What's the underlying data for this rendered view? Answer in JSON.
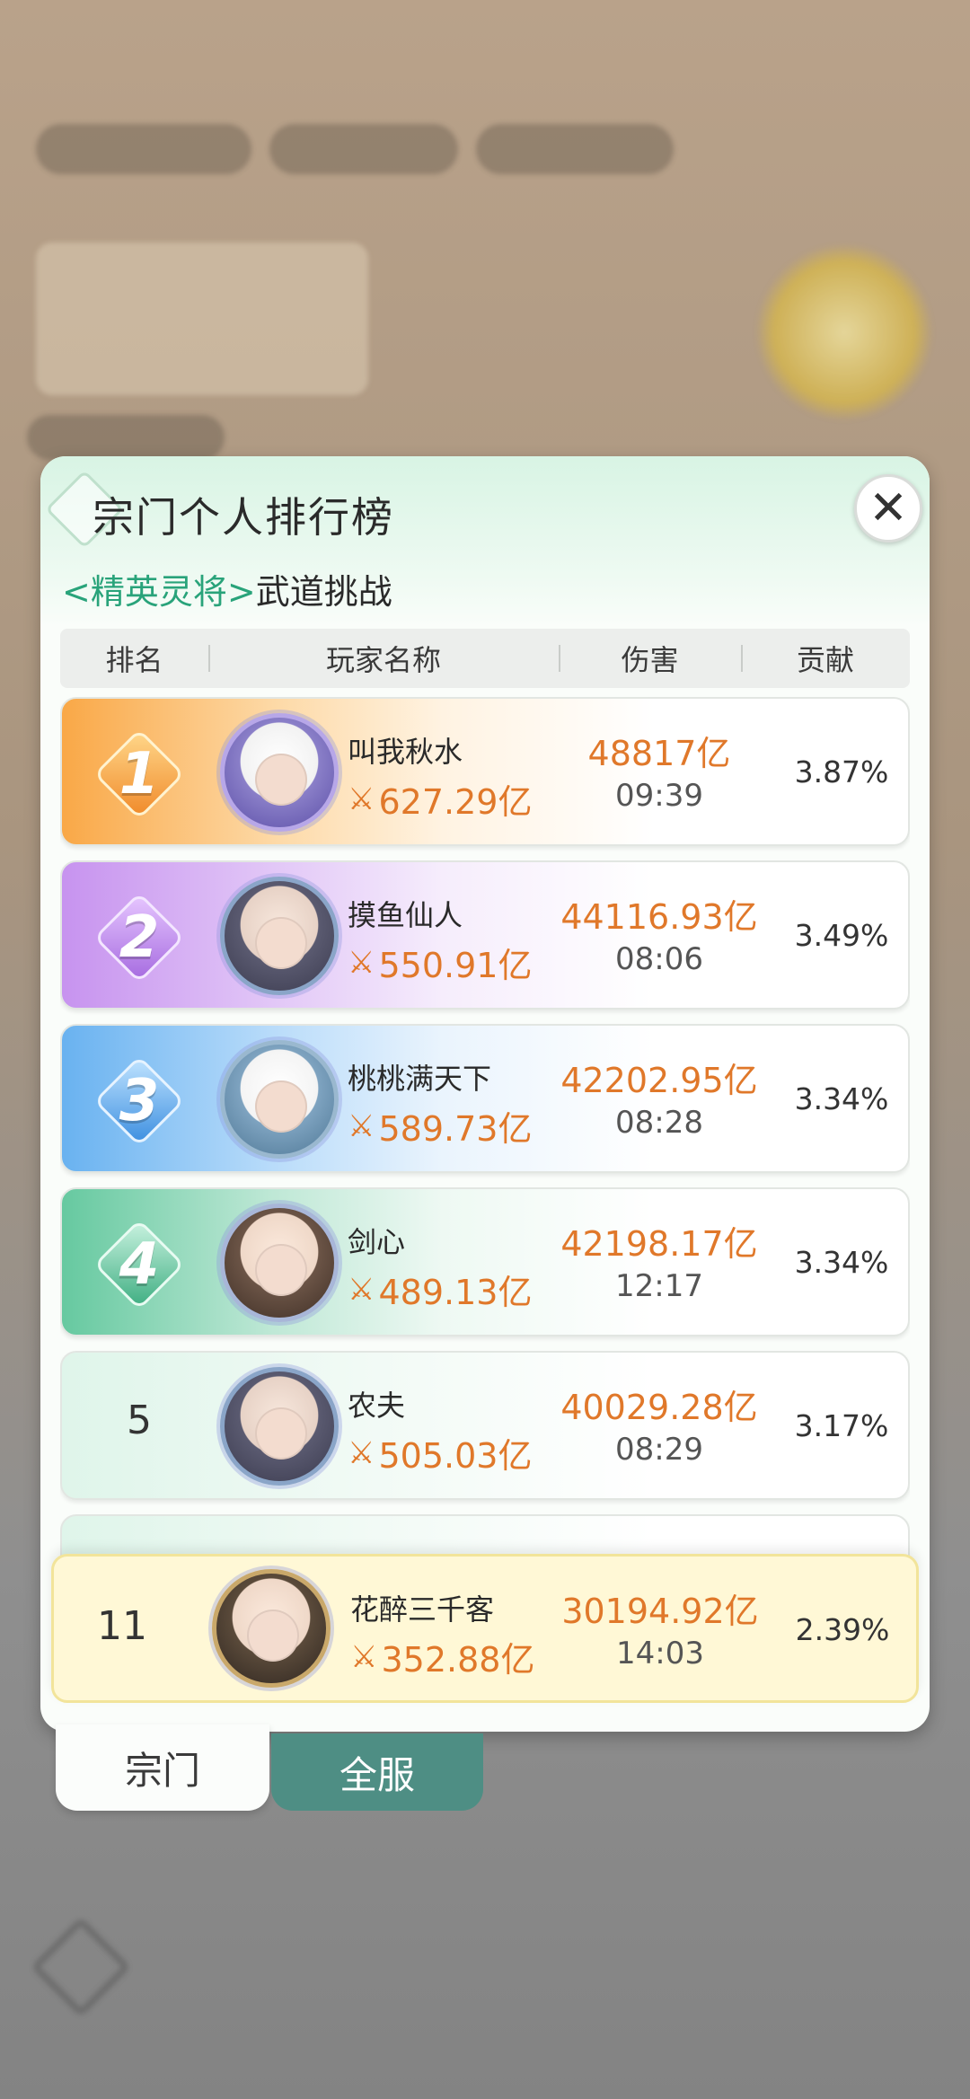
{
  "panel": {
    "title": "宗门个人排行榜",
    "subtitle_tag": "<精英灵将>",
    "subtitle_name": "武道挑战",
    "close_icon": "close-icon"
  },
  "columns": {
    "rank": "排名",
    "player": "玩家名称",
    "damage": "伤害",
    "contribution": "贡献"
  },
  "rows": [
    {
      "rank": "1",
      "name": "叫我秋水",
      "power": "627.29亿",
      "damage": "48817亿",
      "time": "09:39",
      "contribution": "3.87%"
    },
    {
      "rank": "2",
      "name": "摸鱼仙人",
      "power": "550.91亿",
      "damage": "44116.93亿",
      "time": "08:06",
      "contribution": "3.49%"
    },
    {
      "rank": "3",
      "name": "桃桃满天下",
      "power": "589.73亿",
      "damage": "42202.95亿",
      "time": "08:28",
      "contribution": "3.34%"
    },
    {
      "rank": "4",
      "name": "剑心",
      "power": "489.13亿",
      "damage": "42198.17亿",
      "time": "12:17",
      "contribution": "3.34%"
    },
    {
      "rank": "5",
      "name": "农夫",
      "power": "505.03亿",
      "damage": "40029.28亿",
      "time": "08:29",
      "contribution": "3.17%"
    }
  ],
  "self": {
    "rank": "11",
    "name": "花醉三千客",
    "power": "352.88亿",
    "damage": "30194.92亿",
    "time": "14:03",
    "contribution": "2.39%"
  },
  "tabs": {
    "sect": "宗门",
    "all": "全服"
  },
  "colors": {
    "accent_orange": "#e0782a",
    "tag_green": "#29a37a",
    "tab_active": "#4e8e84",
    "rank1": "#f7a94a",
    "rank2": "#b98ae8",
    "rank3": "#5fa9ee",
    "rank4": "#5cc49a"
  }
}
